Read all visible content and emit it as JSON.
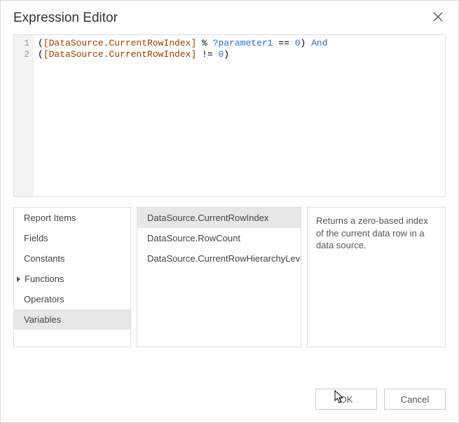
{
  "header": {
    "title": "Expression Editor"
  },
  "code": {
    "lines": [
      {
        "no": "1",
        "segments": [
          {
            "t": "(",
            "c": "tok-black"
          },
          {
            "t": "[DataSource.CurrentRowIndex]",
            "c": "tok-field"
          },
          {
            "t": " % ",
            "c": "tok-black"
          },
          {
            "t": "?parameter1",
            "c": "tok-param"
          },
          {
            "t": " == ",
            "c": "tok-black"
          },
          {
            "t": "0",
            "c": "tok-num"
          },
          {
            "t": ") ",
            "c": "tok-black"
          },
          {
            "t": "And",
            "c": "tok-kw"
          }
        ]
      },
      {
        "no": "2",
        "segments": [
          {
            "t": "(",
            "c": "tok-black"
          },
          {
            "t": "[DataSource.CurrentRowIndex]",
            "c": "tok-field"
          },
          {
            "t": " != ",
            "c": "tok-black"
          },
          {
            "t": "0",
            "c": "tok-num"
          },
          {
            "t": ")",
            "c": "tok-black"
          }
        ]
      }
    ]
  },
  "categories": [
    {
      "label": "Report Items",
      "expandable": false,
      "selected": false
    },
    {
      "label": "Fields",
      "expandable": false,
      "selected": false
    },
    {
      "label": "Constants",
      "expandable": false,
      "selected": false
    },
    {
      "label": "Functions",
      "expandable": true,
      "selected": false
    },
    {
      "label": "Operators",
      "expandable": false,
      "selected": false
    },
    {
      "label": "Variables",
      "expandable": false,
      "selected": true
    }
  ],
  "items": [
    {
      "label": "DataSource.CurrentRowIndex",
      "selected": true
    },
    {
      "label": "DataSource.RowCount",
      "selected": false
    },
    {
      "label": "DataSource.CurrentRowHierarchyLevel",
      "selected": false
    }
  ],
  "description": "Returns a zero-based index of the current data row in a data source.",
  "buttons": {
    "ok": "OK",
    "cancel": "Cancel"
  }
}
